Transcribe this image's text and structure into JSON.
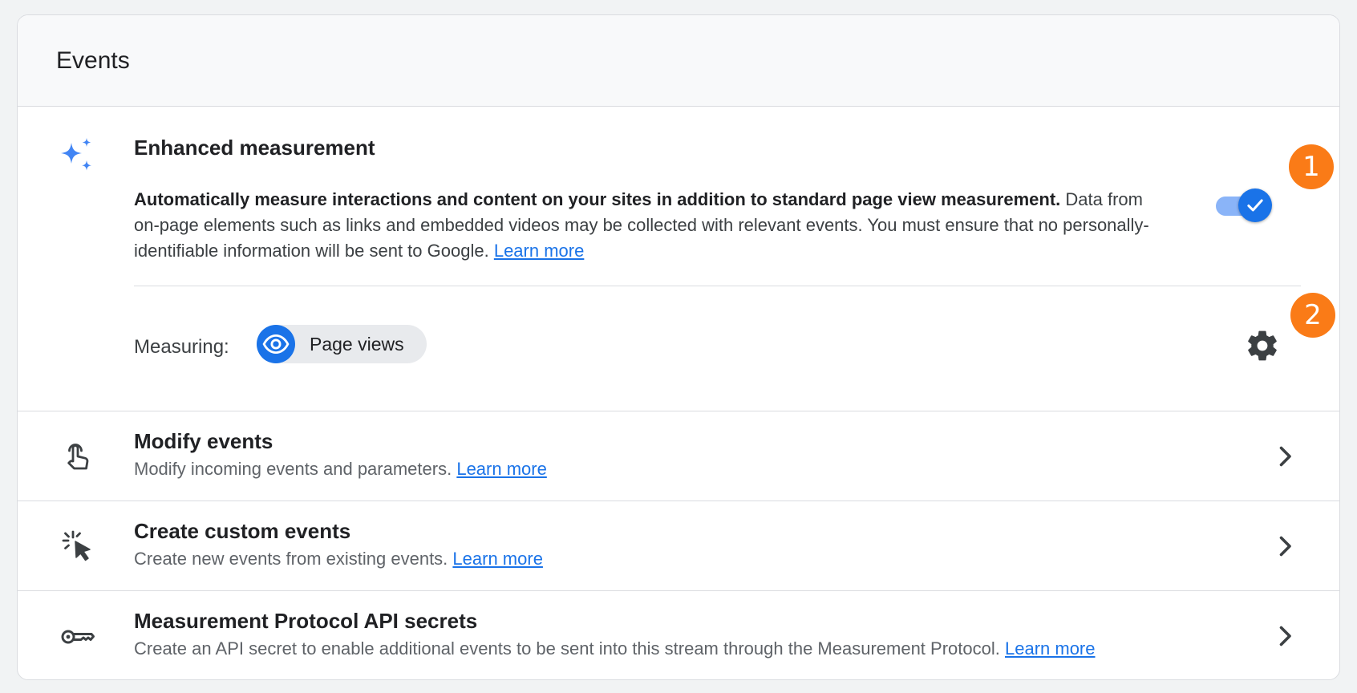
{
  "card": {
    "title": "Events"
  },
  "enhanced": {
    "title": "Enhanced measurement",
    "desc_bold": "Automatically measure interactions and content on your sites in addition to standard page view measurement.",
    "desc_rest": "Data from on-page elements such as links and embedded videos may be collected with relevant events. You must ensure that no personally-identifiable information will be sent to Google.",
    "learn_more": "Learn more",
    "toggle_on": true,
    "measuring_label": "Measuring:",
    "chip_label": "Page views",
    "badge_1": "1",
    "badge_2": "2"
  },
  "rows": [
    {
      "title": "Modify events",
      "desc": "Modify incoming events and parameters.",
      "learn_more": "Learn more",
      "icon": "touch-icon"
    },
    {
      "title": "Create custom events",
      "desc": "Create new events from existing events.",
      "learn_more": "Learn more",
      "icon": "cursor-click-icon"
    },
    {
      "title": "Measurement Protocol API secrets",
      "desc": "Create an API secret to enable additional events to be sent into this stream through the Measurement Protocol.",
      "learn_more": "Learn more",
      "icon": "key-icon"
    }
  ],
  "colors": {
    "accent": "#1a73e8",
    "accent_light": "#8ab4f8",
    "badge": "#fa7b17"
  }
}
